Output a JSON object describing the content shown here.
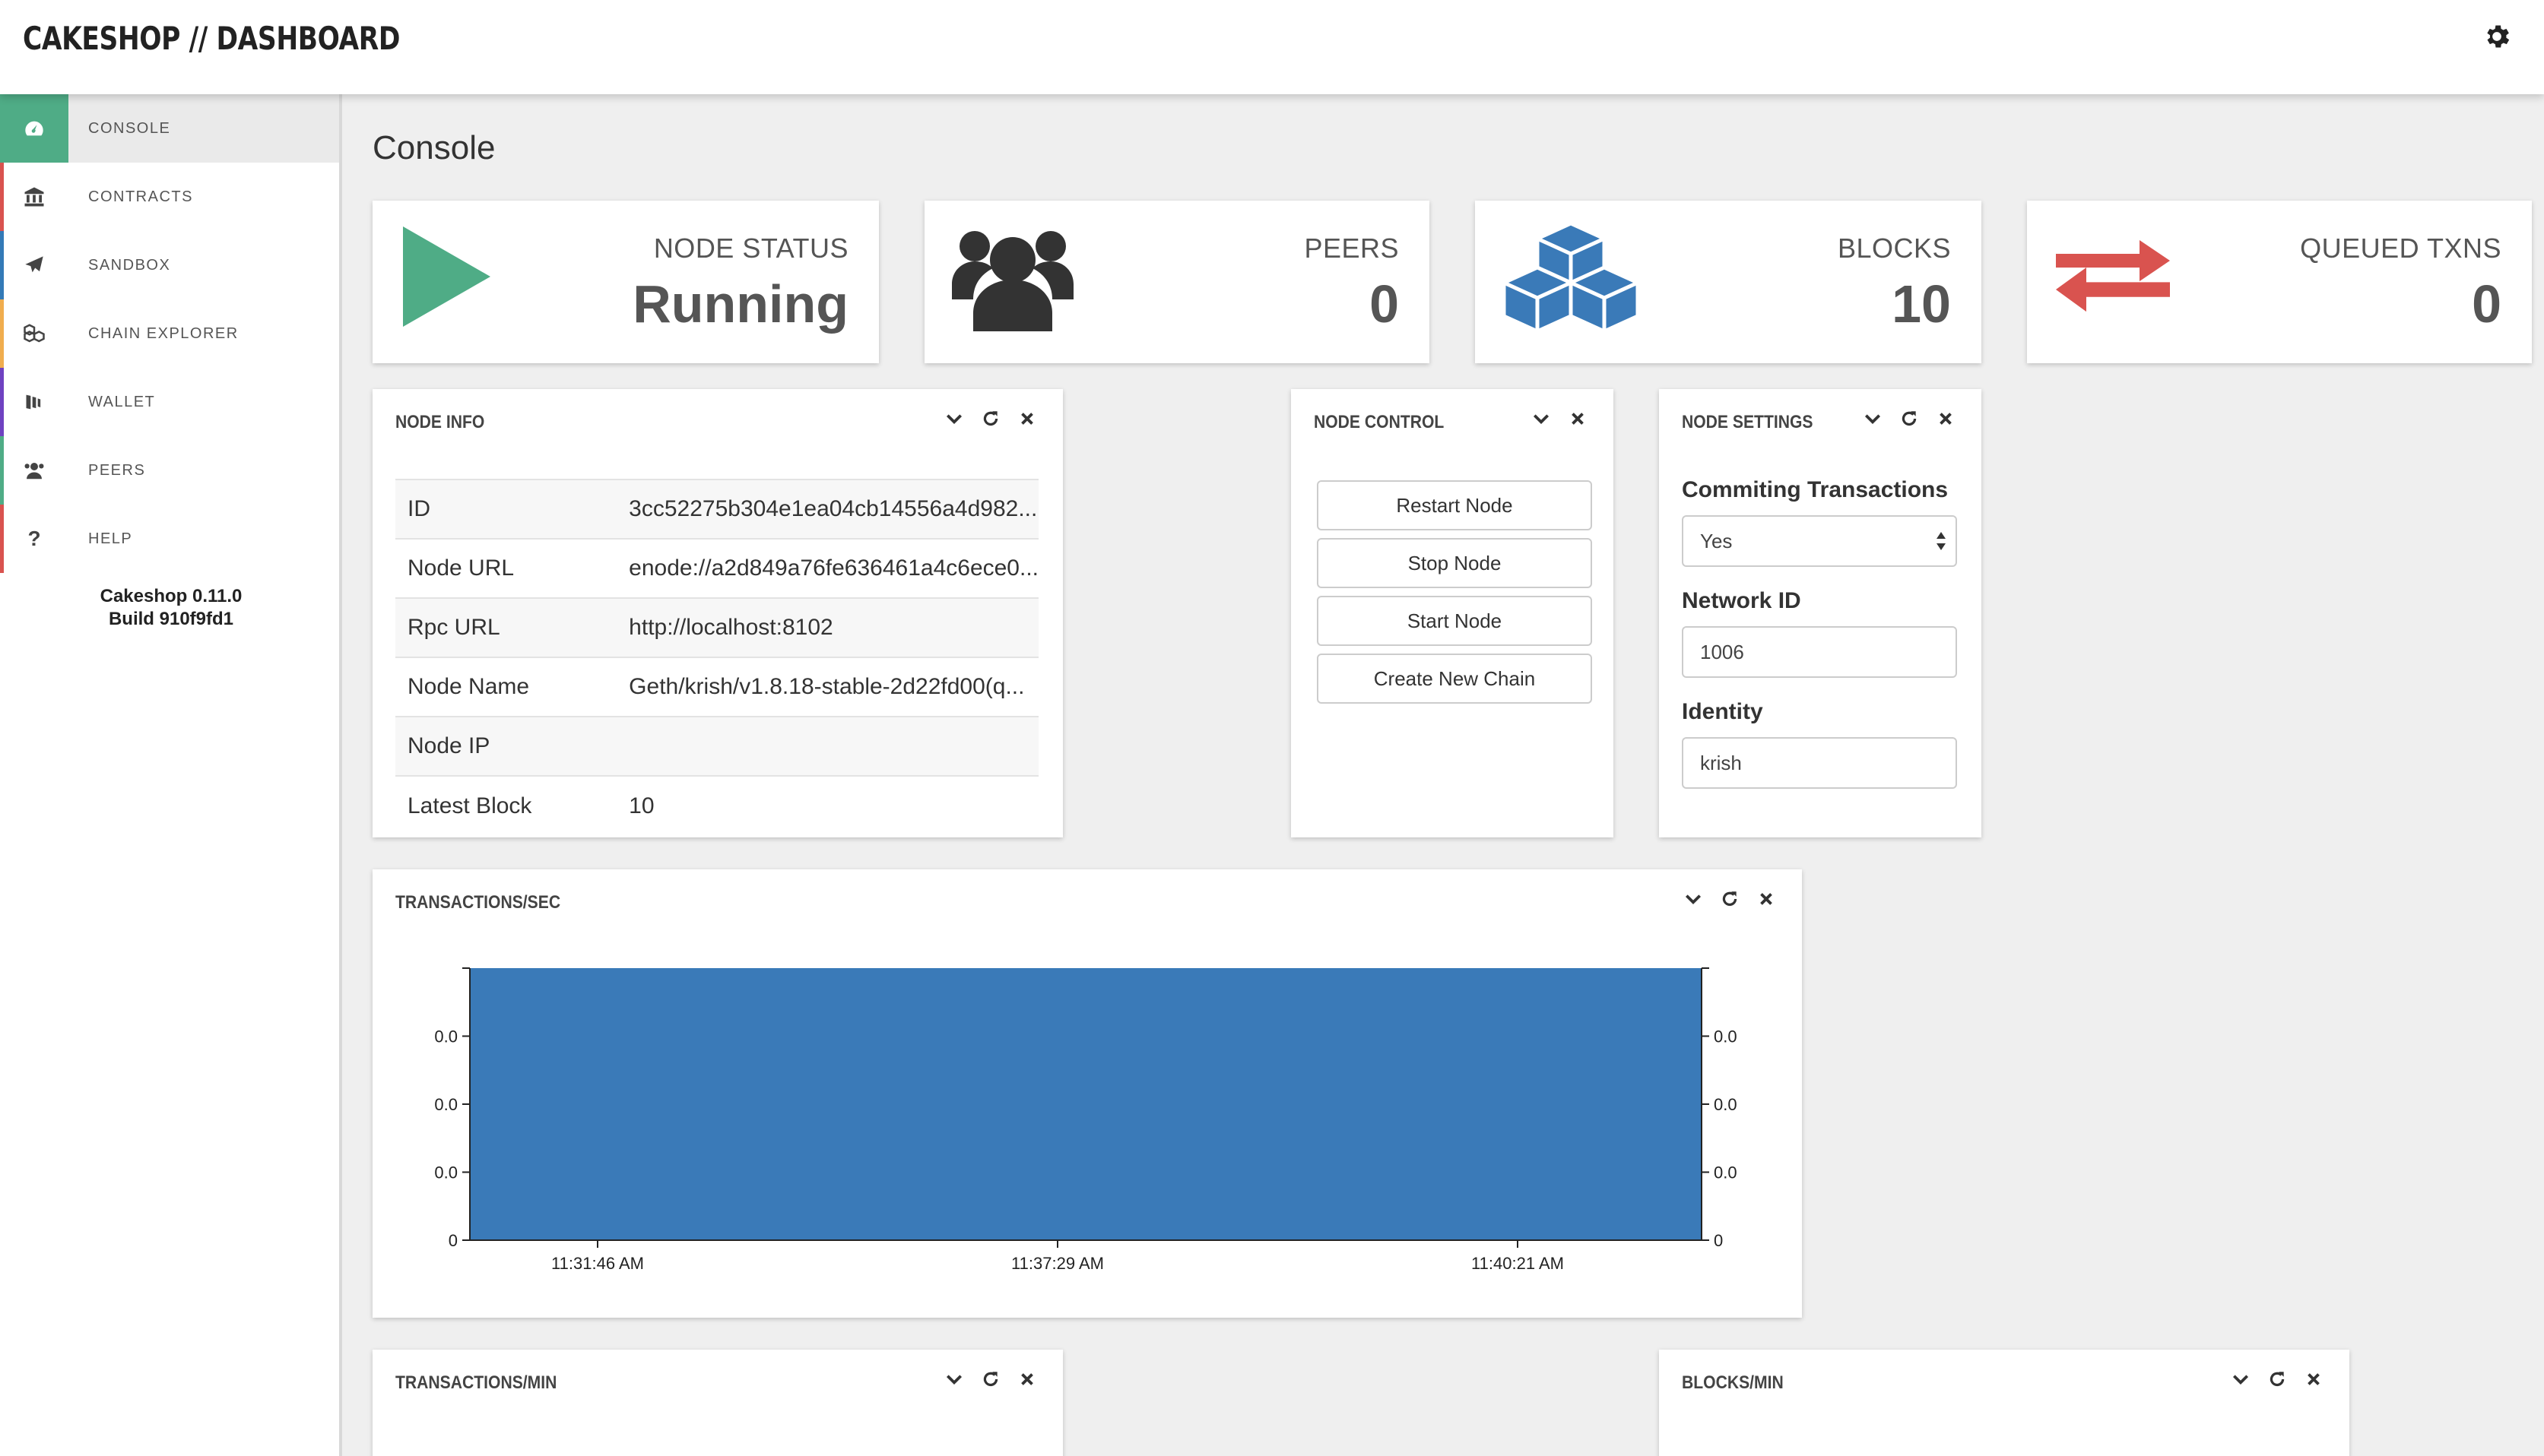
{
  "header": {
    "title": "CAKESHOP // DASHBOARD",
    "settings_icon": "gear-icon"
  },
  "sidebar": {
    "items": [
      {
        "label": "CONSOLE",
        "icon": "dashboard-icon",
        "color": "#4fac86",
        "active": true
      },
      {
        "label": "CONTRACTS",
        "icon": "bank-icon",
        "color": "#d9534f"
      },
      {
        "label": "SANDBOX",
        "icon": "paper-plane-icon",
        "color": "#337ab7"
      },
      {
        "label": "CHAIN EXPLORER",
        "icon": "cubes-icon",
        "color": "#f0ad4e"
      },
      {
        "label": "WALLET",
        "icon": "wallet-icon",
        "color": "#6f42c1"
      },
      {
        "label": "PEERS",
        "icon": "users-icon",
        "color": "#4fac86"
      },
      {
        "label": "HELP",
        "icon": "question-icon",
        "color": "#d9534f"
      }
    ],
    "version_line1": "Cakeshop 0.11.0",
    "version_line2": "Build 910f9fd1"
  },
  "page_title": "Console",
  "stats": {
    "node_status": {
      "label": "NODE STATUS",
      "value": "Running",
      "icon": "play-icon",
      "color": "#4fac86"
    },
    "peers": {
      "label": "PEERS",
      "value": "0",
      "icon": "users-icon",
      "color": "#333333"
    },
    "blocks": {
      "label": "BLOCKS",
      "value": "10",
      "icon": "cubes-icon",
      "color": "#3a7ab8"
    },
    "queued_txns": {
      "label": "QUEUED TXNS",
      "value": "0",
      "icon": "exchange-icon",
      "color": "#d9534f"
    }
  },
  "node_info": {
    "title": "NODE INFO",
    "rows": [
      {
        "key": "ID",
        "value": "3cc52275b304e1ea04cb14556a4d982..."
      },
      {
        "key": "Node URL",
        "value": "enode://a2d849a76fe636461a4c6ece0..."
      },
      {
        "key": "Rpc URL",
        "value": "http://localhost:8102"
      },
      {
        "key": "Node Name",
        "value": "Geth/krish/v1.8.18-stable-2d22fd00(q..."
      },
      {
        "key": "Node IP",
        "value": ""
      },
      {
        "key": "Latest Block",
        "value": "10"
      }
    ]
  },
  "node_control": {
    "title": "NODE CONTROL",
    "buttons": [
      "Restart Node",
      "Stop Node",
      "Start Node",
      "Create New Chain"
    ]
  },
  "node_settings": {
    "title": "NODE SETTINGS",
    "committing_label": "Commiting Transactions",
    "committing_value": "Yes",
    "network_label": "Network ID",
    "network_value": "1006",
    "identity_label": "Identity",
    "identity_value": "krish"
  },
  "tx_sec": {
    "title": "TRANSACTIONS/SEC"
  },
  "tx_min": {
    "title": "TRANSACTIONS/MIN"
  },
  "blocks_min": {
    "title": "BLOCKS/MIN"
  },
  "chart_data": {
    "type": "area",
    "x": [
      "11:31:46 AM",
      "11:37:29 AM",
      "11:40:21 AM"
    ],
    "y_ticks": [
      "0",
      "0.0",
      "0.0",
      "0.0"
    ],
    "series": [
      {
        "values": [
          0,
          0,
          0
        ]
      }
    ],
    "color": "#3a7ab8",
    "grid": false
  }
}
